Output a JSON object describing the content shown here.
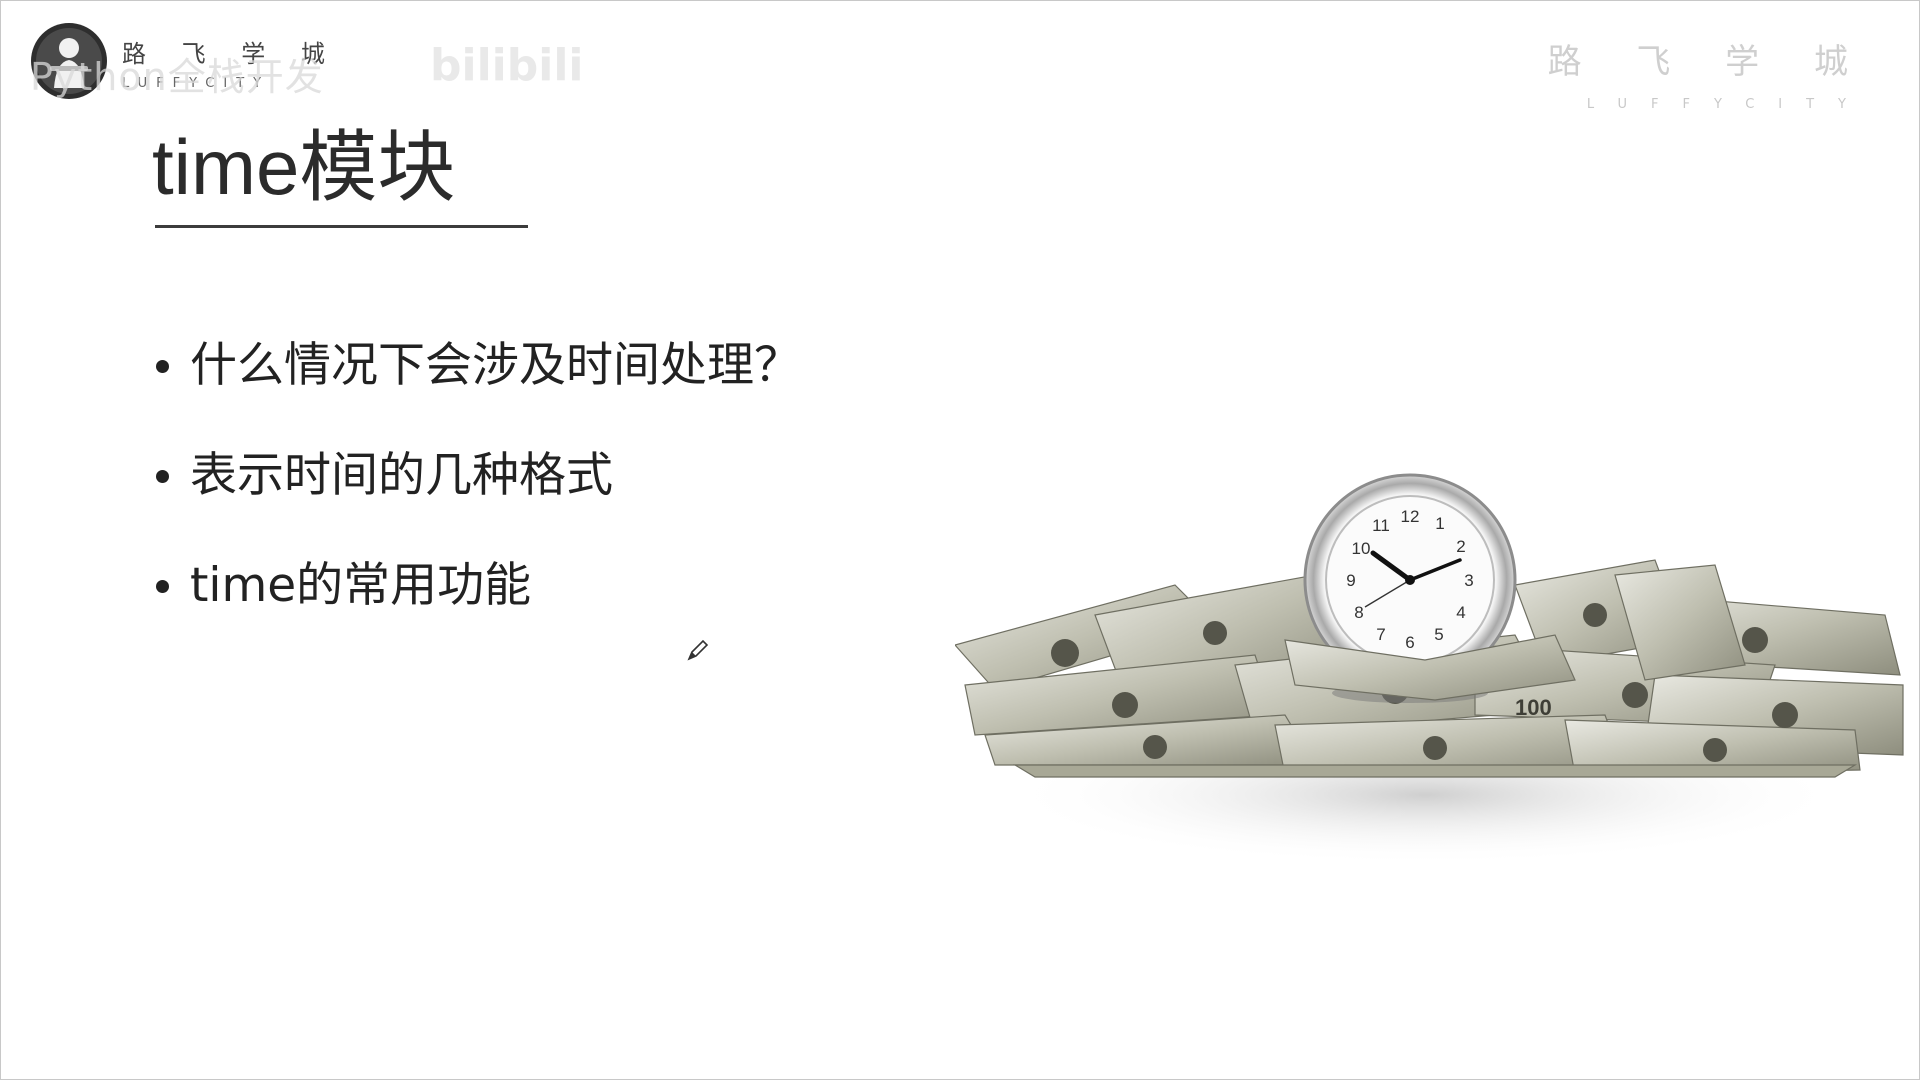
{
  "logo_left": {
    "cn": "路 飞 学 城",
    "en": "LUFFYCITY",
    "watermark": "Python全栈开发",
    "watermark_site": "bilibili"
  },
  "logo_right": {
    "cn": "路 飞 学 城",
    "en": "LUFFYCITY"
  },
  "slide": {
    "title": "time模块",
    "bullets": [
      "什么情况下会涉及时间处理？",
      "表示时间的几种格式",
      "time的常用功能"
    ]
  },
  "illustration": {
    "description_icon": "clock-on-money-icon",
    "clock_numbers": [
      "12",
      "1",
      "2",
      "3",
      "4",
      "5",
      "6",
      "7",
      "8",
      "9",
      "10",
      "11"
    ],
    "bill_label": "100"
  },
  "colors": {
    "text": "#222222",
    "rule": "#3c3c3c",
    "watermark": "#cfcfcf",
    "money": "#9a9a88"
  }
}
